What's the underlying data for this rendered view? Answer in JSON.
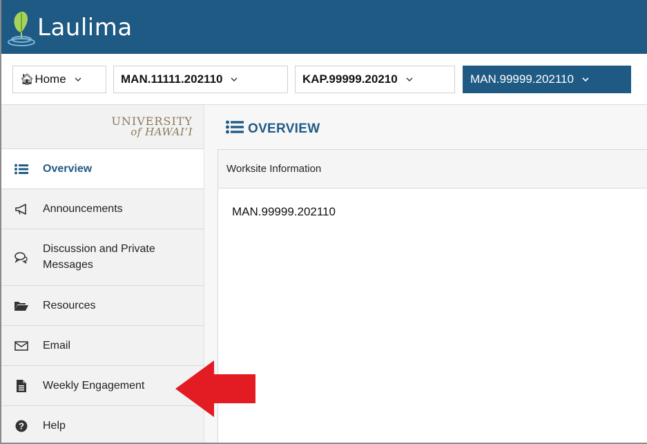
{
  "app": {
    "logo_text": "Laulima"
  },
  "sites": {
    "home": "Home",
    "tab1": "MAN.11111.202110",
    "tab2": "KAP.99999.20210",
    "tab3": "MAN.99999.202110"
  },
  "institution": {
    "line1": "UNIVERSITY",
    "line2": "of HAWAI‘I"
  },
  "sidebar": {
    "items": [
      {
        "label": "Overview",
        "icon": "list-icon",
        "active": true
      },
      {
        "label": "Announcements",
        "icon": "megaphone-icon"
      },
      {
        "label": "Discussion and Private Messages",
        "line1": "Discussion and Private",
        "line2": "Messages",
        "icon": "chat-bubbles-icon"
      },
      {
        "label": "Resources",
        "icon": "folder-open-icon"
      },
      {
        "label": "Email",
        "icon": "envelope-icon"
      },
      {
        "label": "Weekly Engagement",
        "icon": "document-icon"
      },
      {
        "label": "Help",
        "icon": "question-circle-icon"
      }
    ]
  },
  "main": {
    "title": "OVERVIEW",
    "panel_title": "Worksite Information",
    "site_name": "MAN.99999.202110"
  },
  "colors": {
    "brand": "#1f5a84",
    "arrow": "#e31b23",
    "uh_gold": "#8c7a5a"
  }
}
